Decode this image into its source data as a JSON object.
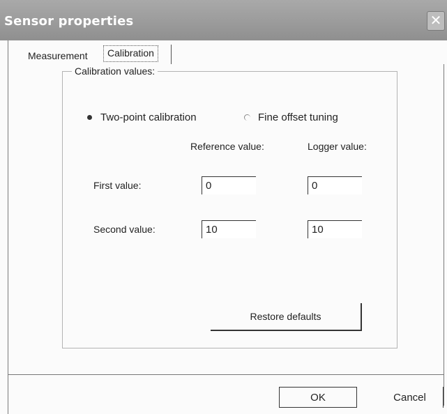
{
  "window": {
    "title": "Sensor properties"
  },
  "tabs": [
    {
      "label": "Measurement"
    },
    {
      "label": "Calibration",
      "selected": true
    }
  ],
  "calibration": {
    "group_label": "Calibration values:",
    "modes": [
      {
        "label": "Two-point calibration",
        "selected": true
      },
      {
        "label": "Fine offset tuning",
        "selected": false
      }
    ],
    "columns": {
      "reference": "Reference value:",
      "logger": "Logger value:"
    },
    "rows": [
      {
        "label": "First value:",
        "reference": "0",
        "logger": "0"
      },
      {
        "label": "Second value:",
        "reference": "10",
        "logger": "10"
      }
    ],
    "restore_label": "Restore defaults"
  },
  "buttons": {
    "ok": "OK",
    "cancel": "Cancel"
  },
  "icons": {
    "close": "close-icon"
  }
}
